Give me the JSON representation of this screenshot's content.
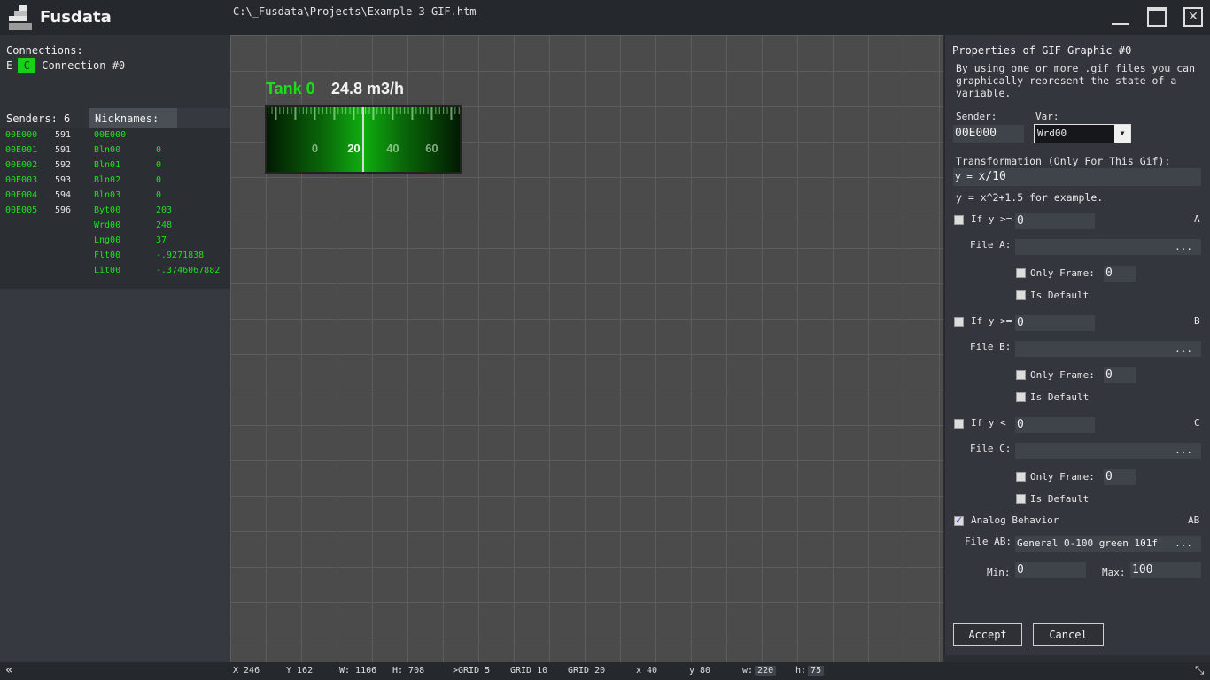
{
  "app": {
    "title": "Fusdata",
    "file_path": "C:\\_Fusdata\\Projects\\Example 3 GIF.htm"
  },
  "connections": {
    "title": "Connections:",
    "e_label": "E",
    "c_label": "C",
    "name": "Connection #0"
  },
  "senders_header": "Senders: 6",
  "nicknames_header": "Nicknames:",
  "senders": [
    {
      "id": "00E000",
      "num": "591"
    },
    {
      "id": "00E001",
      "num": "591"
    },
    {
      "id": "00E002",
      "num": "592"
    },
    {
      "id": "00E003",
      "num": "593"
    },
    {
      "id": "00E004",
      "num": "594"
    },
    {
      "id": "00E005",
      "num": "596"
    }
  ],
  "nicknames": [
    {
      "name": "00E000",
      "value": ""
    },
    {
      "name": "Bln00",
      "value": "0"
    },
    {
      "name": "Bln01",
      "value": "0"
    },
    {
      "name": "Bln02",
      "value": "0"
    },
    {
      "name": "Bln03",
      "value": "0"
    },
    {
      "name": "Byt00",
      "value": "203"
    },
    {
      "name": "Wrd00",
      "value": "248"
    },
    {
      "name": "Lng00",
      "value": "37"
    },
    {
      "name": "Flt00",
      "value": "-.9271838"
    },
    {
      "name": "Lit00",
      "value": "-.3746067882"
    }
  ],
  "gauge": {
    "label": "Tank 0",
    "value": "24.8 m3/h",
    "ticks": [
      "0",
      "20",
      "40",
      "60"
    ],
    "needle_value": 24.8
  },
  "props": {
    "title": "Properties of GIF Graphic #0",
    "description_lines": [
      "By using one or more .gif files you can",
      "graphically represent the state of a",
      "variable."
    ],
    "sender_label": "Sender:",
    "sender_value": "00E000",
    "var_label": "Var:",
    "var_value": "Wrd00",
    "transform_label": "Transformation (Only For This Gif):",
    "transform_prefix": "y = ",
    "transform_value": "x/10",
    "transform_example": "y = x^2+1.5 for example.",
    "conditions": [
      {
        "if_label": "If y >=",
        "value": "0",
        "letter": "A",
        "file_label": "File A:",
        "file_value": "",
        "frame_label": "Only Frame:",
        "frame_value": "0",
        "default_label": "Is Default"
      },
      {
        "if_label": "If y >=",
        "value": "0",
        "letter": "B",
        "file_label": "File B:",
        "file_value": "",
        "frame_label": "Only Frame:",
        "frame_value": "0",
        "default_label": "Is Default"
      },
      {
        "if_label": "If y <",
        "value": "0",
        "letter": "C",
        "file_label": "File C:",
        "file_value": "",
        "frame_label": "Only Frame:",
        "frame_value": "0",
        "default_label": "Is Default"
      }
    ],
    "analog_label": "Analog Behavior",
    "analog_letter": "AB",
    "file_ab_label": "File AB:",
    "file_ab_value": "General 0-100 green 101f",
    "browse": "...",
    "min_label": "Min:",
    "min_value": "0",
    "max_label": "Max:",
    "max_value": "100",
    "accept": "Accept",
    "cancel": "Cancel"
  },
  "status": {
    "x": "X 246",
    "y": "Y 162",
    "w": "W: 1106",
    "h": "H: 708",
    "grid5": ">GRID 5",
    "grid10": "GRID 10",
    "grid20": "GRID 20",
    "sel_x": "x 40",
    "sel_y": "y 80",
    "sel_w_label": "w:",
    "sel_w": "220",
    "sel_h_label": "h:",
    "sel_h": "75"
  },
  "colors": {
    "accent_green": "#19e019",
    "background": "#2b2e33"
  }
}
